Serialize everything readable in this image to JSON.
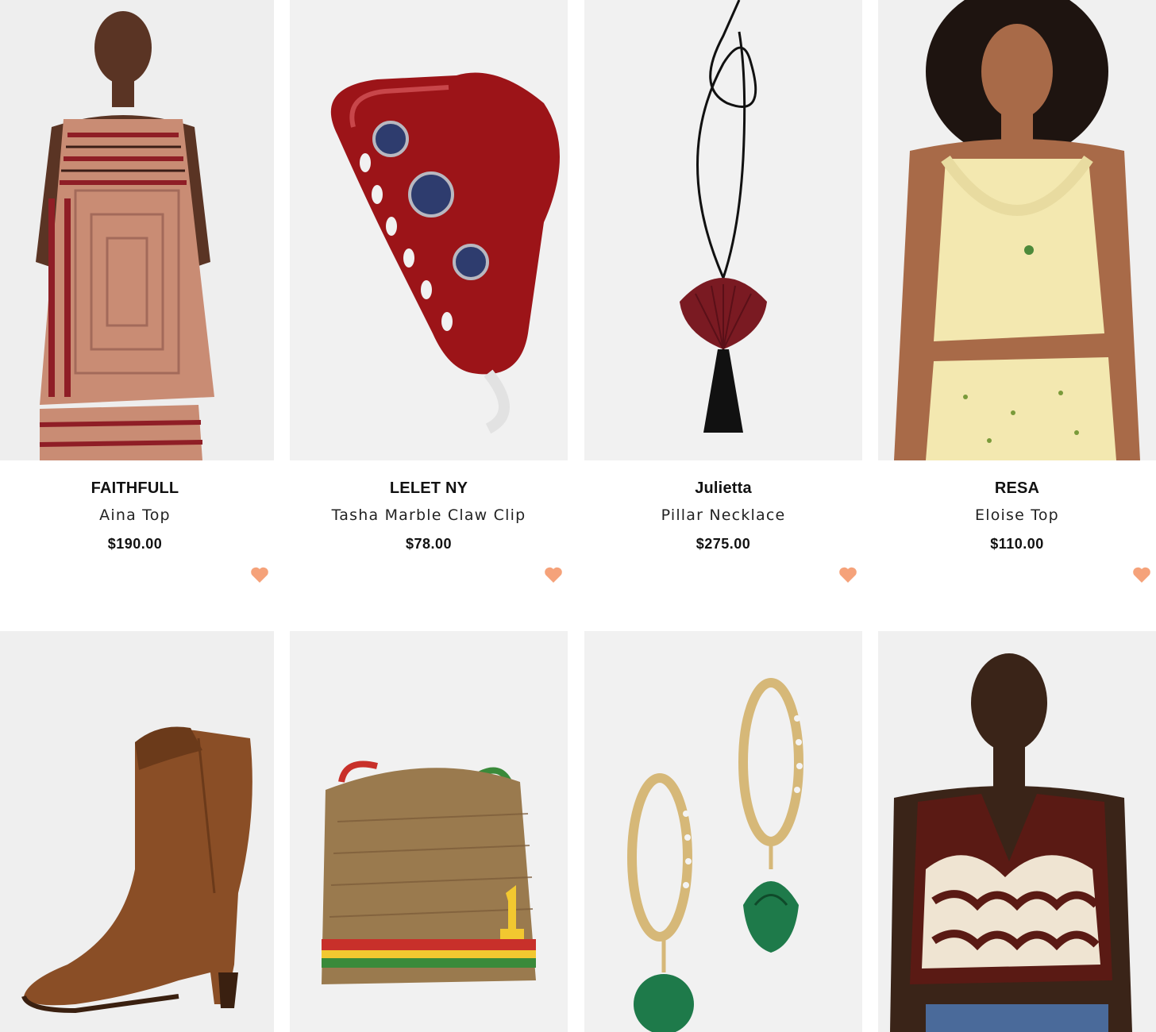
{
  "accent_color": "#f5a27a",
  "products": [
    {
      "brand": "FAITHFULL",
      "name": "Aina Top",
      "price": "$190.00",
      "wishlist_icon": "heart-icon"
    },
    {
      "brand": "LELET NY",
      "name": "Tasha Marble Claw Clip",
      "price": "$78.00",
      "wishlist_icon": "heart-icon"
    },
    {
      "brand": "Julietta",
      "name": "Pillar Necklace",
      "price": "$275.00",
      "wishlist_icon": "heart-icon"
    },
    {
      "brand": "RESA",
      "name": "Eloise Top",
      "price": "$110.00",
      "wishlist_icon": "heart-icon"
    }
  ],
  "product_images": [
    "striped-silk-camisole-photo",
    "red-claw-clip-photo",
    "shell-pendant-necklace-photo",
    "lace-floral-top-photo",
    "brown-western-boot-photo",
    "monogram-shoulder-bag-photo",
    "malachite-hoop-earrings-photo",
    "palm-wave-knit-vest-photo"
  ]
}
